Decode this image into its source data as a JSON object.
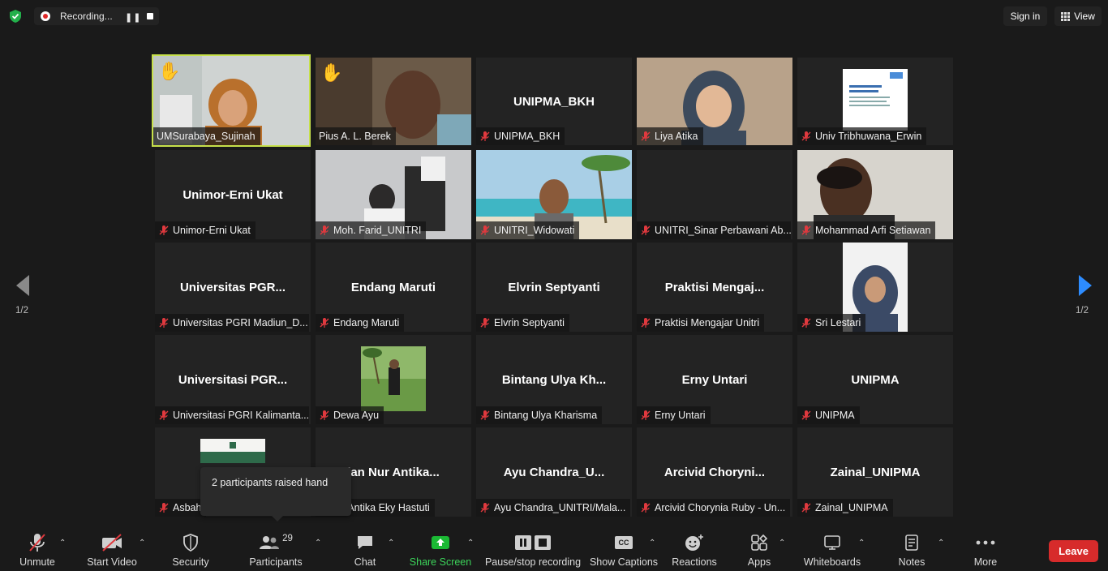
{
  "topbar": {
    "recording_label": "Recording...",
    "pause_glyph": "❚❚",
    "sign_in": "Sign in",
    "view": "View"
  },
  "pagination": {
    "left": "1/2",
    "right": "1/2"
  },
  "participants": [
    {
      "big": "",
      "label": "UMSurabaya_Sujinah",
      "muted": false,
      "hand": true,
      "active": true
    },
    {
      "big": "",
      "label": "Pius A. L. Berek",
      "muted": false,
      "hand": true
    },
    {
      "big": "UNIPMA_BKH",
      "label": "UNIPMA_BKH",
      "muted": true
    },
    {
      "big": "",
      "label": "Liya Atika",
      "muted": true
    },
    {
      "big": "",
      "label": "Univ Tribhuwana_Erwin",
      "muted": true
    },
    {
      "big": "Unimor-Erni Ukat",
      "label": "Unimor-Erni Ukat",
      "muted": true
    },
    {
      "big": "",
      "label": "Moh. Farid_UNITRI",
      "muted": true
    },
    {
      "big": "",
      "label": "UNITRI_Widowati",
      "muted": true
    },
    {
      "big": "",
      "label": "UNITRI_Sinar Perbawani Ab...",
      "muted": true
    },
    {
      "big": "",
      "label": "Mohammad Arfi Setiawan",
      "muted": true
    },
    {
      "big": "Universitas  PGR...",
      "label": "Universitas PGRI Madiun_D...",
      "muted": true
    },
    {
      "big": "Endang Maruti",
      "label": "Endang Maruti",
      "muted": true
    },
    {
      "big": "Elvrin Septyanti",
      "label": "Elvrin Septyanti",
      "muted": true
    },
    {
      "big": "Praktisi  Mengaj...",
      "label": "Praktisi Mengajar Unitri",
      "muted": true
    },
    {
      "big": "",
      "label": "Sri Lestari",
      "muted": true
    },
    {
      "big": "Universitasi  PGR...",
      "label": "Universitasi PGRI Kalimanta...",
      "muted": true
    },
    {
      "big": "",
      "label": "Dewa Ayu",
      "muted": true
    },
    {
      "big": "Bintang Ulya Kh...",
      "label": "Bintang Ulya Kharisma",
      "muted": true
    },
    {
      "big": "Erny Untari",
      "label": "Erny Untari",
      "muted": true
    },
    {
      "big": "UNIPMA",
      "label": "UNIPMA",
      "muted": true
    },
    {
      "big": "",
      "label": "Asbah",
      "muted": true
    },
    {
      "big": "ian Nur Antika...",
      "label": "n Nur Antika Eky Hastuti",
      "muted": false
    },
    {
      "big": "Ayu  Chandra_U...",
      "label": "Ayu Chandra_UNITRI/Mala...",
      "muted": true
    },
    {
      "big": "Arcivid  Chorynі...",
      "label": "Arcivid Chorynia Ruby - Un...",
      "muted": true
    },
    {
      "big": "Zainal_UNIPMA",
      "label": "Zainal_UNIPMA",
      "muted": true
    }
  ],
  "tooltip": "2 participants raised hand",
  "toolbar": {
    "unmute": "Unmute",
    "start_video": "Start Video",
    "security": "Security",
    "participants": "Participants",
    "participants_count": "29",
    "chat": "Chat",
    "share_screen": "Share Screen",
    "pause_recording": "Pause/stop recording",
    "captions_badge": "CC",
    "show_captions": "Show Captions",
    "reactions": "Reactions",
    "apps": "Apps",
    "whiteboards": "Whiteboards",
    "notes": "Notes",
    "more": "More",
    "leave": "Leave"
  },
  "colors": {
    "active_border": "#c6e04a",
    "leave": "#d72b2b",
    "share": "#1bb934",
    "mute_red": "#e0393e"
  }
}
